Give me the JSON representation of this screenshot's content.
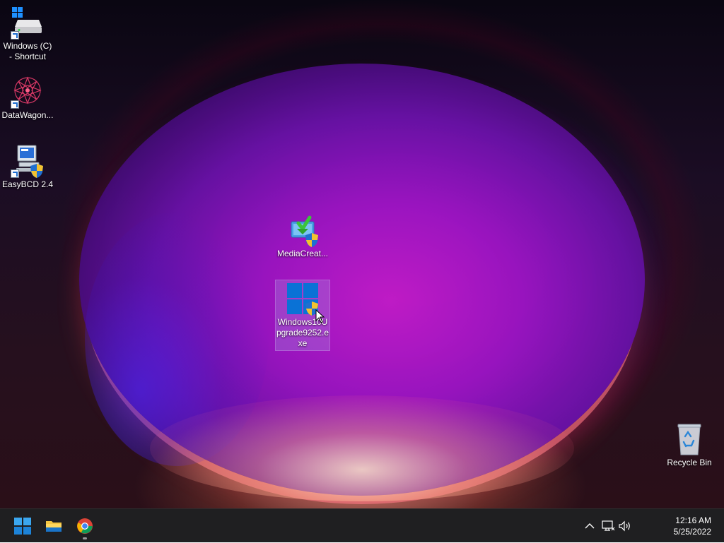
{
  "desktop": {
    "icons": [
      {
        "label": "Windows (C)\n- Shortcut"
      },
      {
        "label": "DataWagon..."
      },
      {
        "label": "EasyBCD 2.4"
      },
      {
        "label": "MediaCreat..."
      },
      {
        "label": "Windows10U\npgrade9252.e\nxe"
      },
      {
        "label": "Recycle Bin"
      }
    ]
  },
  "taskbar": {
    "pinned": [
      "start-button",
      "file-explorer",
      "chrome"
    ],
    "tray": {
      "time": "12:16 AM",
      "date": "5/25/2022"
    }
  },
  "colors": {
    "taskbar_bg": "#1f1f21",
    "accent": "#0078d4",
    "selection": "#a08cdc"
  }
}
